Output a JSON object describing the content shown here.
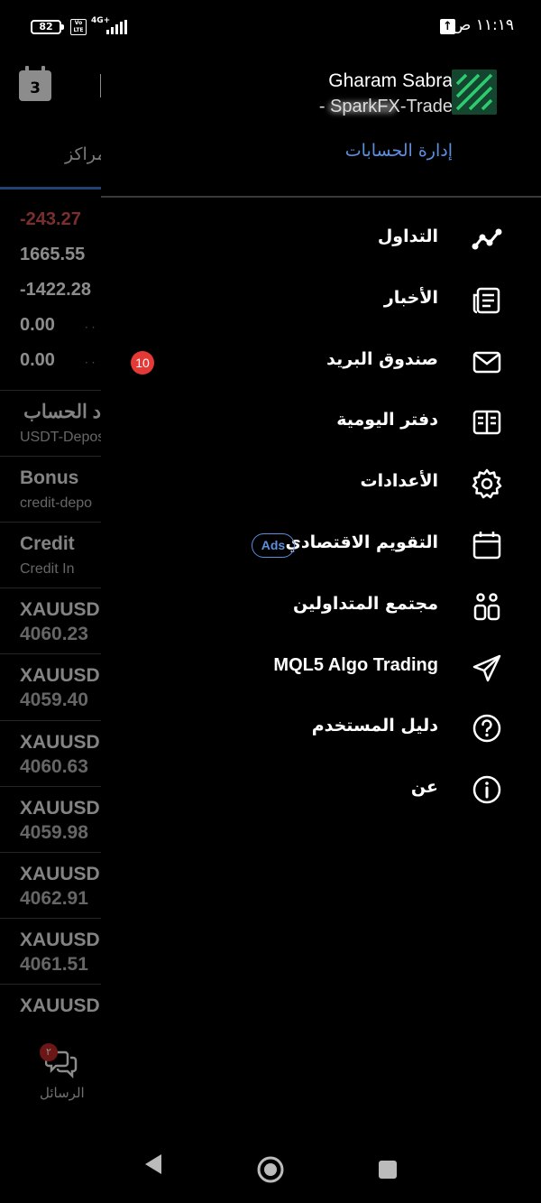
{
  "status_bar": {
    "battery": "82",
    "volte": "Vo LTE",
    "network": "4G+",
    "time": "١١:١٩ ص"
  },
  "background_app": {
    "calendar_day": "3",
    "tab_label": "مراكز",
    "values": [
      "-243.27",
      "1665.55",
      "-1422.28",
      "0.00",
      "0.00"
    ],
    "accent_colors": {
      "negative": "#e05555",
      "tab_underline": "#3a7bd5"
    },
    "entries": [
      {
        "title": "د الحساب",
        "sub": "USDT-Depos"
      },
      {
        "title": "Bonus",
        "sub": "credit-depo"
      },
      {
        "title": "Credit",
        "sub": "Credit In"
      }
    ],
    "trades": [
      {
        "symbol": "XAUUSD,",
        "price": "4060.23"
      },
      {
        "symbol": "XAUUSD,",
        "price": "4059.40"
      },
      {
        "symbol": "XAUUSD,",
        "price": "4060.63"
      },
      {
        "symbol": "XAUUSD,",
        "price": "4059.98"
      },
      {
        "symbol": "XAUUSD,",
        "price": "4062.91"
      },
      {
        "symbol": "XAUUSD,",
        "price": "4061.51"
      },
      {
        "symbol": "XAUUSD,",
        "price": ""
      }
    ],
    "messages_badge": "٢",
    "messages_label": "الرسائل"
  },
  "drawer": {
    "account_name": "Gharam  Sabra",
    "account_server": "- SparkFX-Trade",
    "manage_accounts": "إدارة الحسابات",
    "menu": [
      {
        "label": "التداول",
        "icon": "trading-chart-icon"
      },
      {
        "label": "الأخبار",
        "icon": "news-icon"
      },
      {
        "label": "صندوق البريد",
        "icon": "mail-icon",
        "badge": "10"
      },
      {
        "label": "دفتر اليومية",
        "icon": "journal-icon"
      },
      {
        "label": "الأعدادات",
        "icon": "gear-icon"
      },
      {
        "label": "التقويم الاقتصادي",
        "icon": "calendar-icon",
        "pill": "Ads"
      },
      {
        "label": "مجتمع المتداولين",
        "icon": "community-icon"
      },
      {
        "label": "MQL5 Algo Trading",
        "icon": "send-icon"
      },
      {
        "label": "دليل المستخدم",
        "icon": "help-icon"
      },
      {
        "label": "عن",
        "icon": "info-icon"
      }
    ],
    "colors": {
      "link": "#5b8fe0",
      "badge": "#e53935",
      "logo_bg": "#14452f",
      "logo_fg": "#2ecc71"
    }
  }
}
